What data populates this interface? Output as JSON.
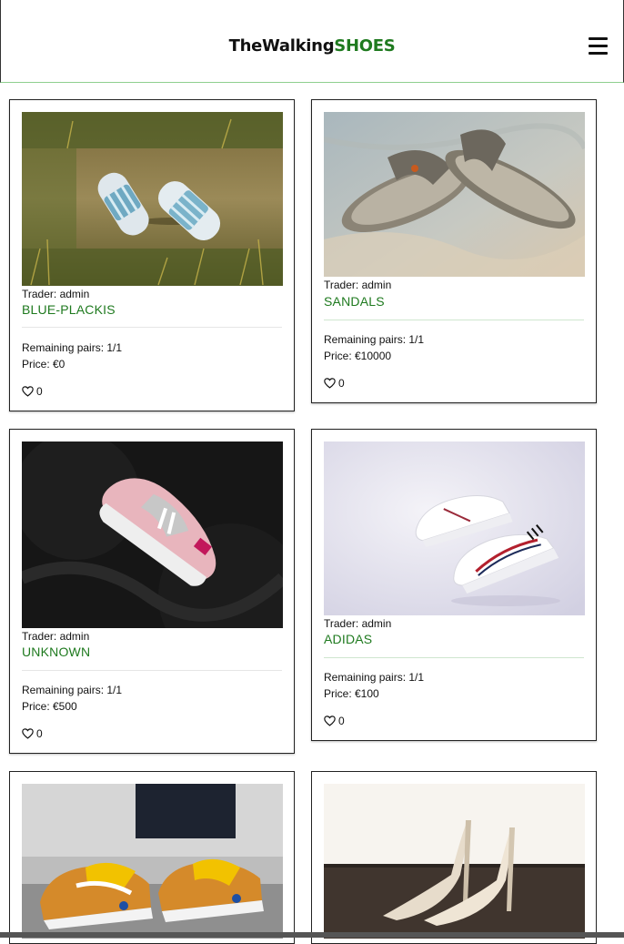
{
  "header": {
    "brand_prefix": "TheWalking",
    "brand_accent": "SHOES",
    "menu_icon": "hamburger-menu-icon"
  },
  "colors": {
    "accent": "#1f7a1f",
    "separator_green": "#cfe6cf",
    "separator_gray": "#e6e6e6"
  },
  "products": [
    {
      "trader": "Trader: admin",
      "title": "BLUE-PLACKIS",
      "remaining": "Remaining pairs: 1/1",
      "price": "Price: €0",
      "likes": "0",
      "image": "blue-slides-on-grass"
    },
    {
      "trader": "Trader: admin",
      "title": "SANDALS",
      "remaining": "Remaining pairs: 1/1",
      "price": "Price: €10000",
      "likes": "0",
      "image": "sandals-on-sand"
    },
    {
      "trader": "Trader: admin",
      "title": "UNKNOWN",
      "remaining": "Remaining pairs: 1/1",
      "price": "Price: €500",
      "likes": "0",
      "image": "pink-sneaker-on-dark-fabric"
    },
    {
      "trader": "Trader: admin",
      "title": "ADIDAS",
      "remaining": "Remaining pairs: 1/1",
      "price": "Price: €100",
      "likes": "0",
      "image": "white-adidas-sneakers"
    },
    {
      "image": "orange-air-max-sneakers"
    },
    {
      "image": "beige-high-heels"
    }
  ]
}
